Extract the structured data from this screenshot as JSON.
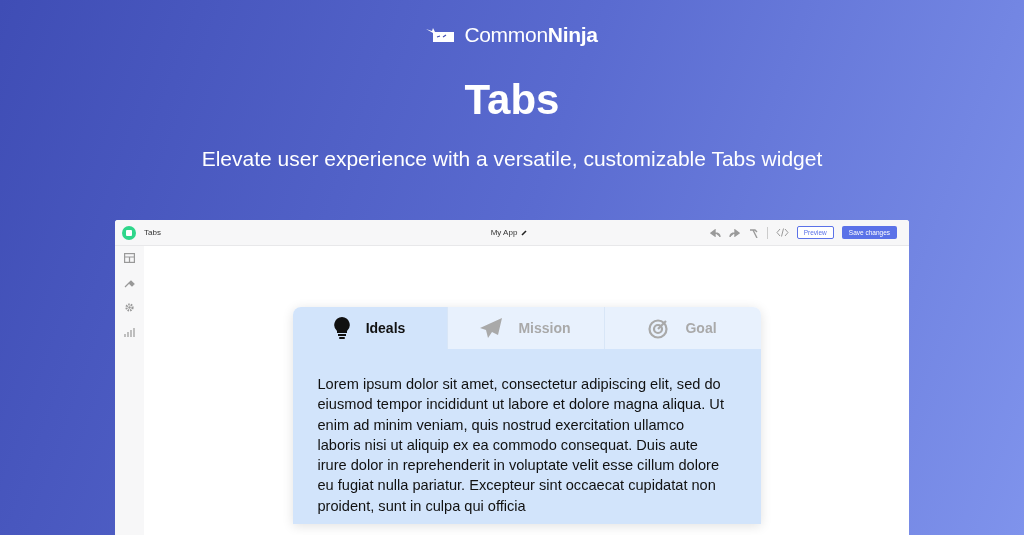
{
  "brand": {
    "name": "Common**Ninja**"
  },
  "hero": {
    "title": "Tabs",
    "subtitle": "Elevate user experience with a versatile, customizable Tabs widget"
  },
  "app": {
    "title": "Tabs",
    "project": "My App",
    "preview_button": "Preview",
    "save_button": "Save changes",
    "sidebar": [
      {
        "kind": "table"
      },
      {
        "kind": "brush"
      },
      {
        "kind": "gear"
      },
      {
        "kind": "chart"
      }
    ],
    "tabs": [
      {
        "label": "Ideals",
        "kind": "bulb",
        "selected": true
      },
      {
        "label": "Mission",
        "kind": "plane",
        "selected": false
      },
      {
        "label": "Goal",
        "kind": "target",
        "selected": false
      }
    ],
    "content": "Lorem ipsum dolor sit amet, consectetur adipiscing elit, sed do eiusmod tempor incididunt ut labore et dolore magna aliqua. Ut enim ad minim veniam, quis nostrud exercitation ullamco laboris nisi ut aliquip ex ea commodo consequat. Duis aute irure dolor in reprehenderit in voluptate velit esse cillum dolore eu fugiat nulla pariatur. Excepteur sint occaecat cupidatat non proident, sunt in culpa qui officia"
  }
}
